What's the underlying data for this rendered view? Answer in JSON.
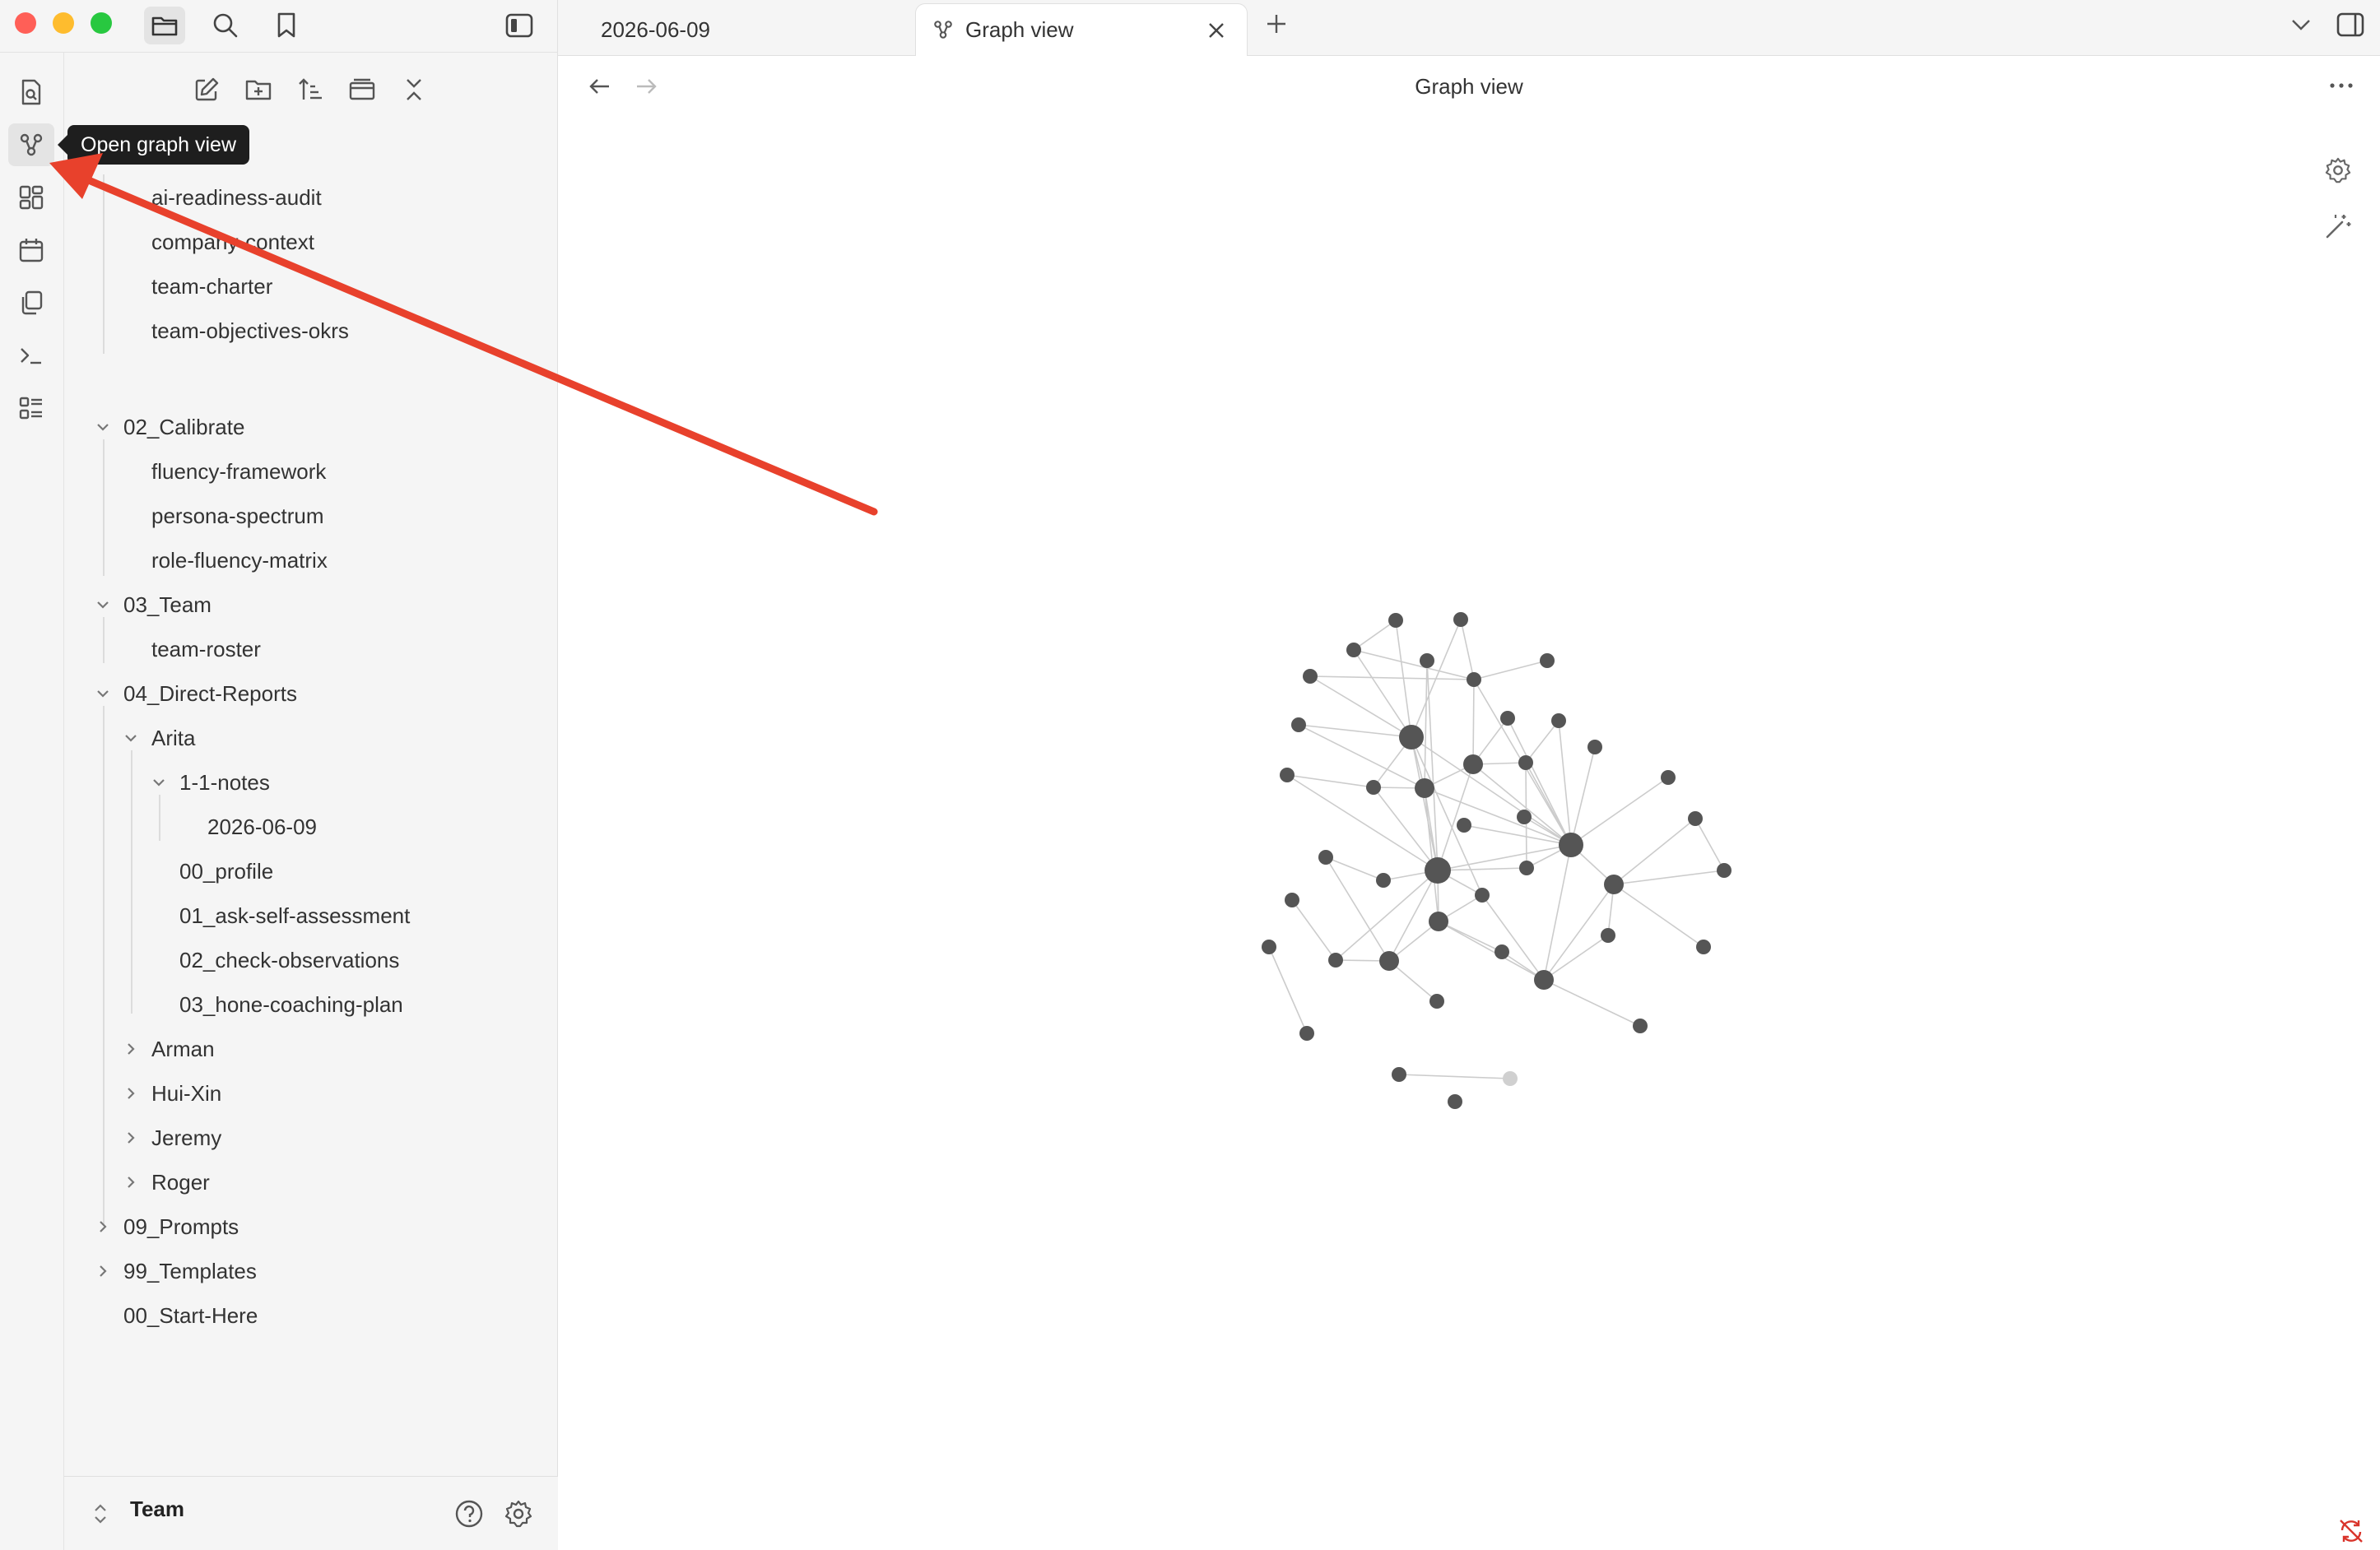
{
  "tabs": [
    {
      "label": "2026-06-09"
    },
    {
      "label": "Graph view",
      "icon": "graph-icon"
    }
  ],
  "view": {
    "title": "Graph view"
  },
  "tooltip": {
    "text": "Open graph view"
  },
  "ribbon": [
    "open-quick-switcher-icon",
    "graph-icon",
    "canvas-icon",
    "calendar-icon",
    "templates-icon",
    "terminal-icon",
    "command-palette-icon"
  ],
  "explorer": {
    "toolbar": [
      "new-note-icon",
      "new-folder-icon",
      "sort-icon",
      "auto-reveal-icon",
      "collapse-all-icon"
    ],
    "tree": [
      {
        "label": "ai-readiness-audit"
      },
      {
        "label": "company-context"
      },
      {
        "label": "team-charter"
      },
      {
        "label": "team-objectives-okrs"
      },
      {
        "label": "02_Calibrate"
      },
      {
        "label": "fluency-framework"
      },
      {
        "label": "persona-spectrum"
      },
      {
        "label": "role-fluency-matrix"
      },
      {
        "label": "03_Team"
      },
      {
        "label": "team-roster"
      },
      {
        "label": "04_Direct-Reports"
      },
      {
        "label": "Arita"
      },
      {
        "label": "1-1-notes"
      },
      {
        "label": "2026-06-09"
      },
      {
        "label": "00_profile"
      },
      {
        "label": "01_ask-self-assessment"
      },
      {
        "label": "02_check-observations"
      },
      {
        "label": "03_hone-coaching-plan"
      },
      {
        "label": "Arman"
      },
      {
        "label": "Hui-Xin"
      },
      {
        "label": "Jeremy"
      },
      {
        "label": "Roger"
      },
      {
        "label": "09_Prompts"
      },
      {
        "label": "99_Templates"
      },
      {
        "label": "00_Start-Here"
      }
    ]
  },
  "vault": {
    "name": "Team"
  },
  "colors": {
    "accent_arrow": "#e8412c",
    "node": "#555555",
    "edge": "#cccccc"
  }
}
